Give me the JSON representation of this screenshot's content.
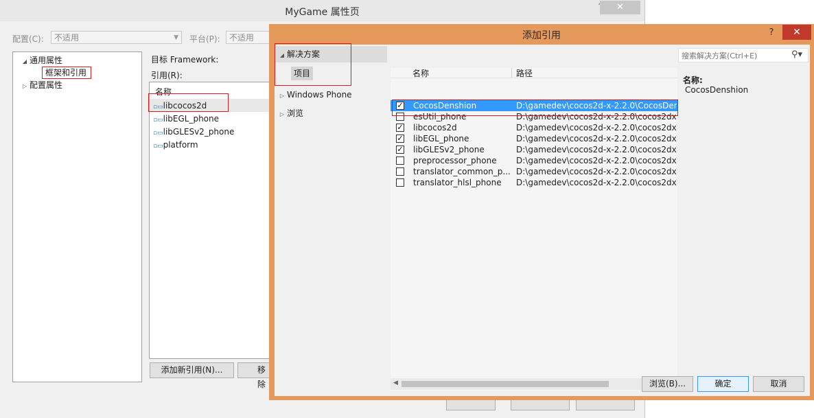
{
  "props_window": {
    "title": "MyGame 属性页",
    "help_btn": "?",
    "close_btn": "✕",
    "config_label": "配置(C):",
    "config_value": "不适用",
    "platform_label": "平台(P):",
    "platform_value": "不适用",
    "tree": {
      "common_props": "通用属性",
      "framework_refs": "框架和引用",
      "config_props": "配置属性"
    },
    "target_framework_label": "目标 Framework:",
    "references_label": "引用(R):",
    "refs_column": "名称",
    "refs": [
      "libcocos2d",
      "libEGL_phone",
      "libGLESv2_phone",
      "platform"
    ],
    "add_ref_button": "添加新引用(N)...",
    "remove_button": "移除"
  },
  "add_ref_dialog": {
    "title": "添加引用",
    "help_btn": "?",
    "close_btn": "✕",
    "nav": {
      "solution": "解决方案",
      "projects": "项目",
      "windows_phone": "Windows Phone",
      "browse": "浏览"
    },
    "search_placeholder": "搜索解决方案(Ctrl+E)",
    "columns": {
      "name": "名称",
      "path": "路径"
    },
    "items": [
      {
        "checked": true,
        "name": "CocosDenshion",
        "path": "D:\\gamedev\\cocos2d-x-2.2.0\\CocosDen"
      },
      {
        "checked": false,
        "name": "esUtil_phone",
        "path": "D:\\gamedev\\cocos2d-x-2.2.0\\cocos2dx\\"
      },
      {
        "checked": true,
        "name": "libcocos2d",
        "path": "D:\\gamedev\\cocos2d-x-2.2.0\\cocos2dx\\"
      },
      {
        "checked": true,
        "name": "libEGL_phone",
        "path": "D:\\gamedev\\cocos2d-x-2.2.0\\cocos2dx\\"
      },
      {
        "checked": true,
        "name": "libGLESv2_phone",
        "path": "D:\\gamedev\\cocos2d-x-2.2.0\\cocos2dx\\"
      },
      {
        "checked": false,
        "name": "preprocessor_phone",
        "path": "D:\\gamedev\\cocos2d-x-2.2.0\\cocos2dx\\"
      },
      {
        "checked": false,
        "name": "translator_common_p...",
        "path": "D:\\gamedev\\cocos2d-x-2.2.0\\cocos2dx\\"
      },
      {
        "checked": false,
        "name": "translator_hlsl_phone",
        "path": "D:\\gamedev\\cocos2d-x-2.2.0\\cocos2dx\\"
      }
    ],
    "details": {
      "name_label": "名称:",
      "name_value": "CocosDenshion"
    },
    "browse_button": "浏览(B)...",
    "ok_button": "确定",
    "cancel_button": "取消"
  }
}
